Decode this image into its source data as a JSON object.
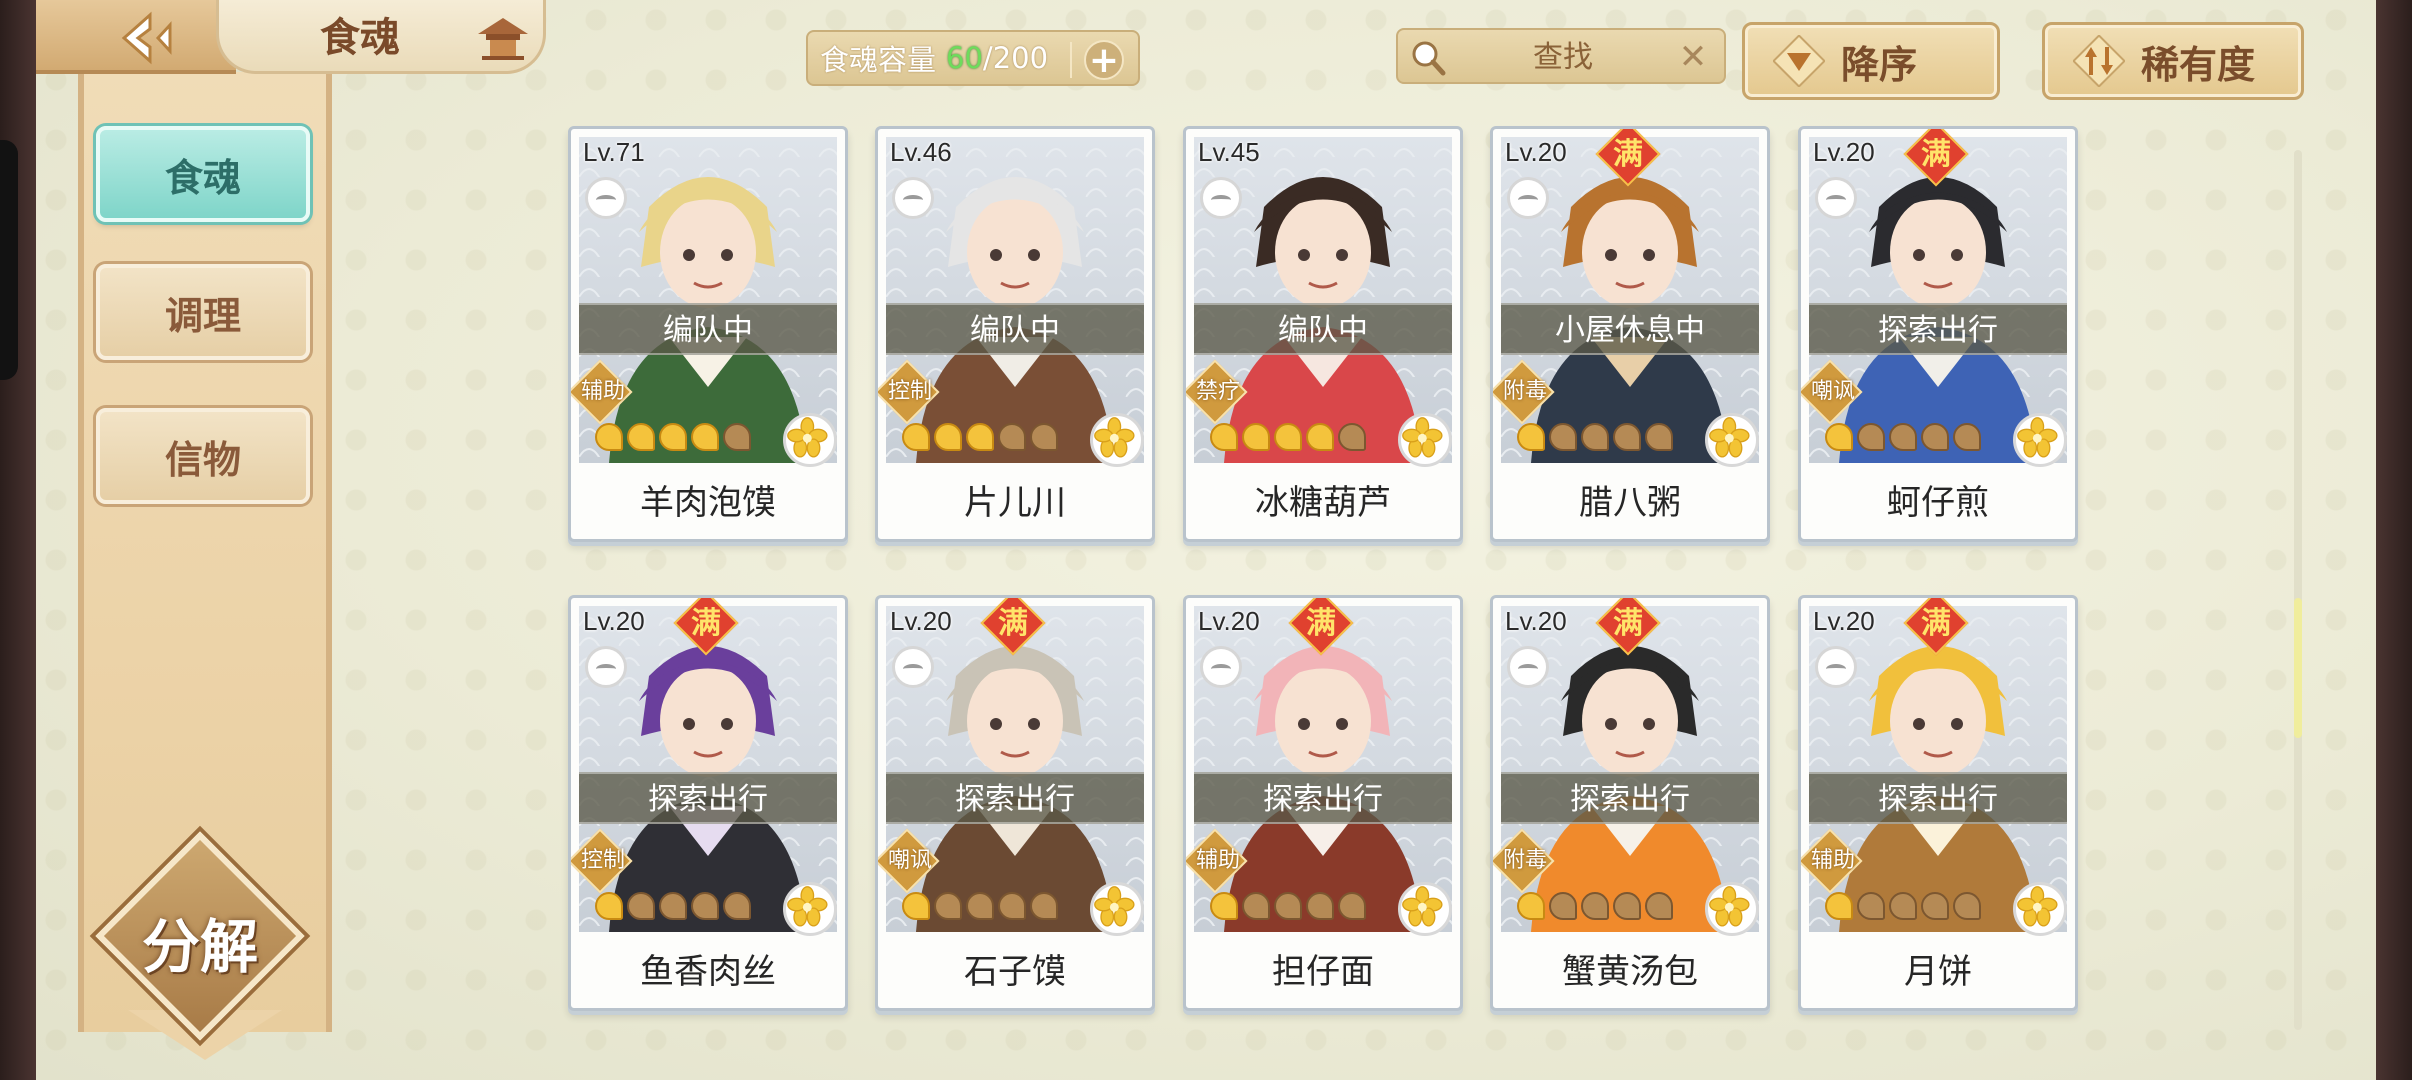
{
  "header": {
    "title": "食魂",
    "capacity_label": "食魂容量",
    "capacity_current": "60",
    "capacity_max": "/200",
    "search_placeholder": "查找",
    "sort_order_label": "降序",
    "sort_field_label": "稀有度"
  },
  "sidebar": {
    "tabs": [
      {
        "label": "食魂",
        "active": true
      },
      {
        "label": "调理",
        "active": false
      },
      {
        "label": "信物",
        "active": false
      }
    ],
    "decompose_label": "分解"
  },
  "colors": {
    "accent_teal": "#7fd5c9",
    "gold": "#f4c33c",
    "full_badge": "#e0412f"
  },
  "cards": [
    {
      "level": "Lv.71",
      "full": false,
      "status": "编队中",
      "role": "辅助",
      "stars_on": 4,
      "name": "羊肉泡馍",
      "palette": [
        "#e9d48a",
        "#3d6b3a",
        "#f7f2e6"
      ]
    },
    {
      "level": "Lv.46",
      "full": false,
      "status": "编队中",
      "role": "控制",
      "stars_on": 3,
      "name": "片儿川",
      "palette": [
        "#e5e5e5",
        "#7a4f36",
        "#f0ede6"
      ]
    },
    {
      "level": "Lv.45",
      "full": false,
      "status": "编队中",
      "role": "禁疗",
      "stars_on": 4,
      "name": "冰糖葫芦",
      "palette": [
        "#3a2b24",
        "#d9474a",
        "#f6e7e0"
      ]
    },
    {
      "level": "Lv.20",
      "full": true,
      "status": "小屋休息中",
      "role": "附毒",
      "stars_on": 1,
      "name": "腊八粥",
      "palette": [
        "#b8732f",
        "#2f3a4a",
        "#e8cfa8"
      ]
    },
    {
      "level": "Lv.20",
      "full": true,
      "status": "探索出行",
      "role": "嘲讽",
      "stars_on": 1,
      "name": "蚵仔煎",
      "palette": [
        "#2b2b2f",
        "#3e63b5",
        "#f1efe9"
      ]
    },
    {
      "level": "Lv.20",
      "full": true,
      "status": "探索出行",
      "role": "控制",
      "stars_on": 1,
      "name": "鱼香肉丝",
      "palette": [
        "#6a3f9c",
        "#2f2f35",
        "#e6dcf0"
      ]
    },
    {
      "level": "Lv.20",
      "full": true,
      "status": "探索出行",
      "role": "嘲讽",
      "stars_on": 1,
      "name": "石子馍",
      "palette": [
        "#c9c3b6",
        "#6b4a33",
        "#efe6d8"
      ]
    },
    {
      "level": "Lv.20",
      "full": true,
      "status": "探索出行",
      "role": "辅助",
      "stars_on": 1,
      "name": "担仔面",
      "palette": [
        "#f2b4b8",
        "#8a3a2a",
        "#f7efe9"
      ]
    },
    {
      "level": "Lv.20",
      "full": true,
      "status": "探索出行",
      "role": "附毒",
      "stars_on": 1,
      "name": "蟹黄汤包",
      "palette": [
        "#2a2a2a",
        "#f08a2c",
        "#f6f1e8"
      ]
    },
    {
      "level": "Lv.20",
      "full": true,
      "status": "探索出行",
      "role": "辅助",
      "stars_on": 1,
      "name": "月饼",
      "palette": [
        "#f1c03c",
        "#b07a3a",
        "#fbf2da"
      ]
    }
  ]
}
